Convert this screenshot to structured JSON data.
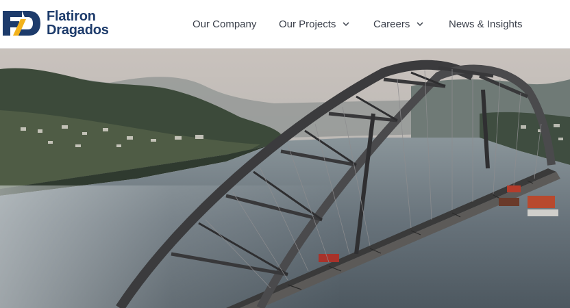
{
  "brand": {
    "name_line1": "Flatiron",
    "name_line2": "Dragados",
    "logo_letters": "FD",
    "colors": {
      "navy": "#1d3b6b",
      "gold": "#f2b21c"
    }
  },
  "nav": {
    "items": [
      {
        "label": "Our Company",
        "has_dropdown": false
      },
      {
        "label": "Our Projects",
        "has_dropdown": true
      },
      {
        "label": "Careers",
        "has_dropdown": true
      },
      {
        "label": "News & Insights",
        "has_dropdown": false
      }
    ]
  },
  "hero": {
    "image_subject": "steel arch bridge under construction over a river"
  }
}
